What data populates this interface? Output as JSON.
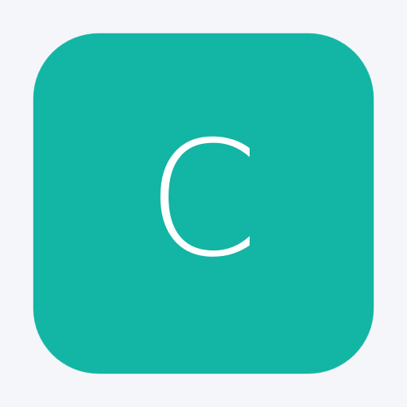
{
  "app_icon": {
    "letter": "C",
    "background_color": "#13B5A4",
    "letter_color": "#FFFFFF"
  },
  "page": {
    "background_color": "#F5F6FA"
  }
}
